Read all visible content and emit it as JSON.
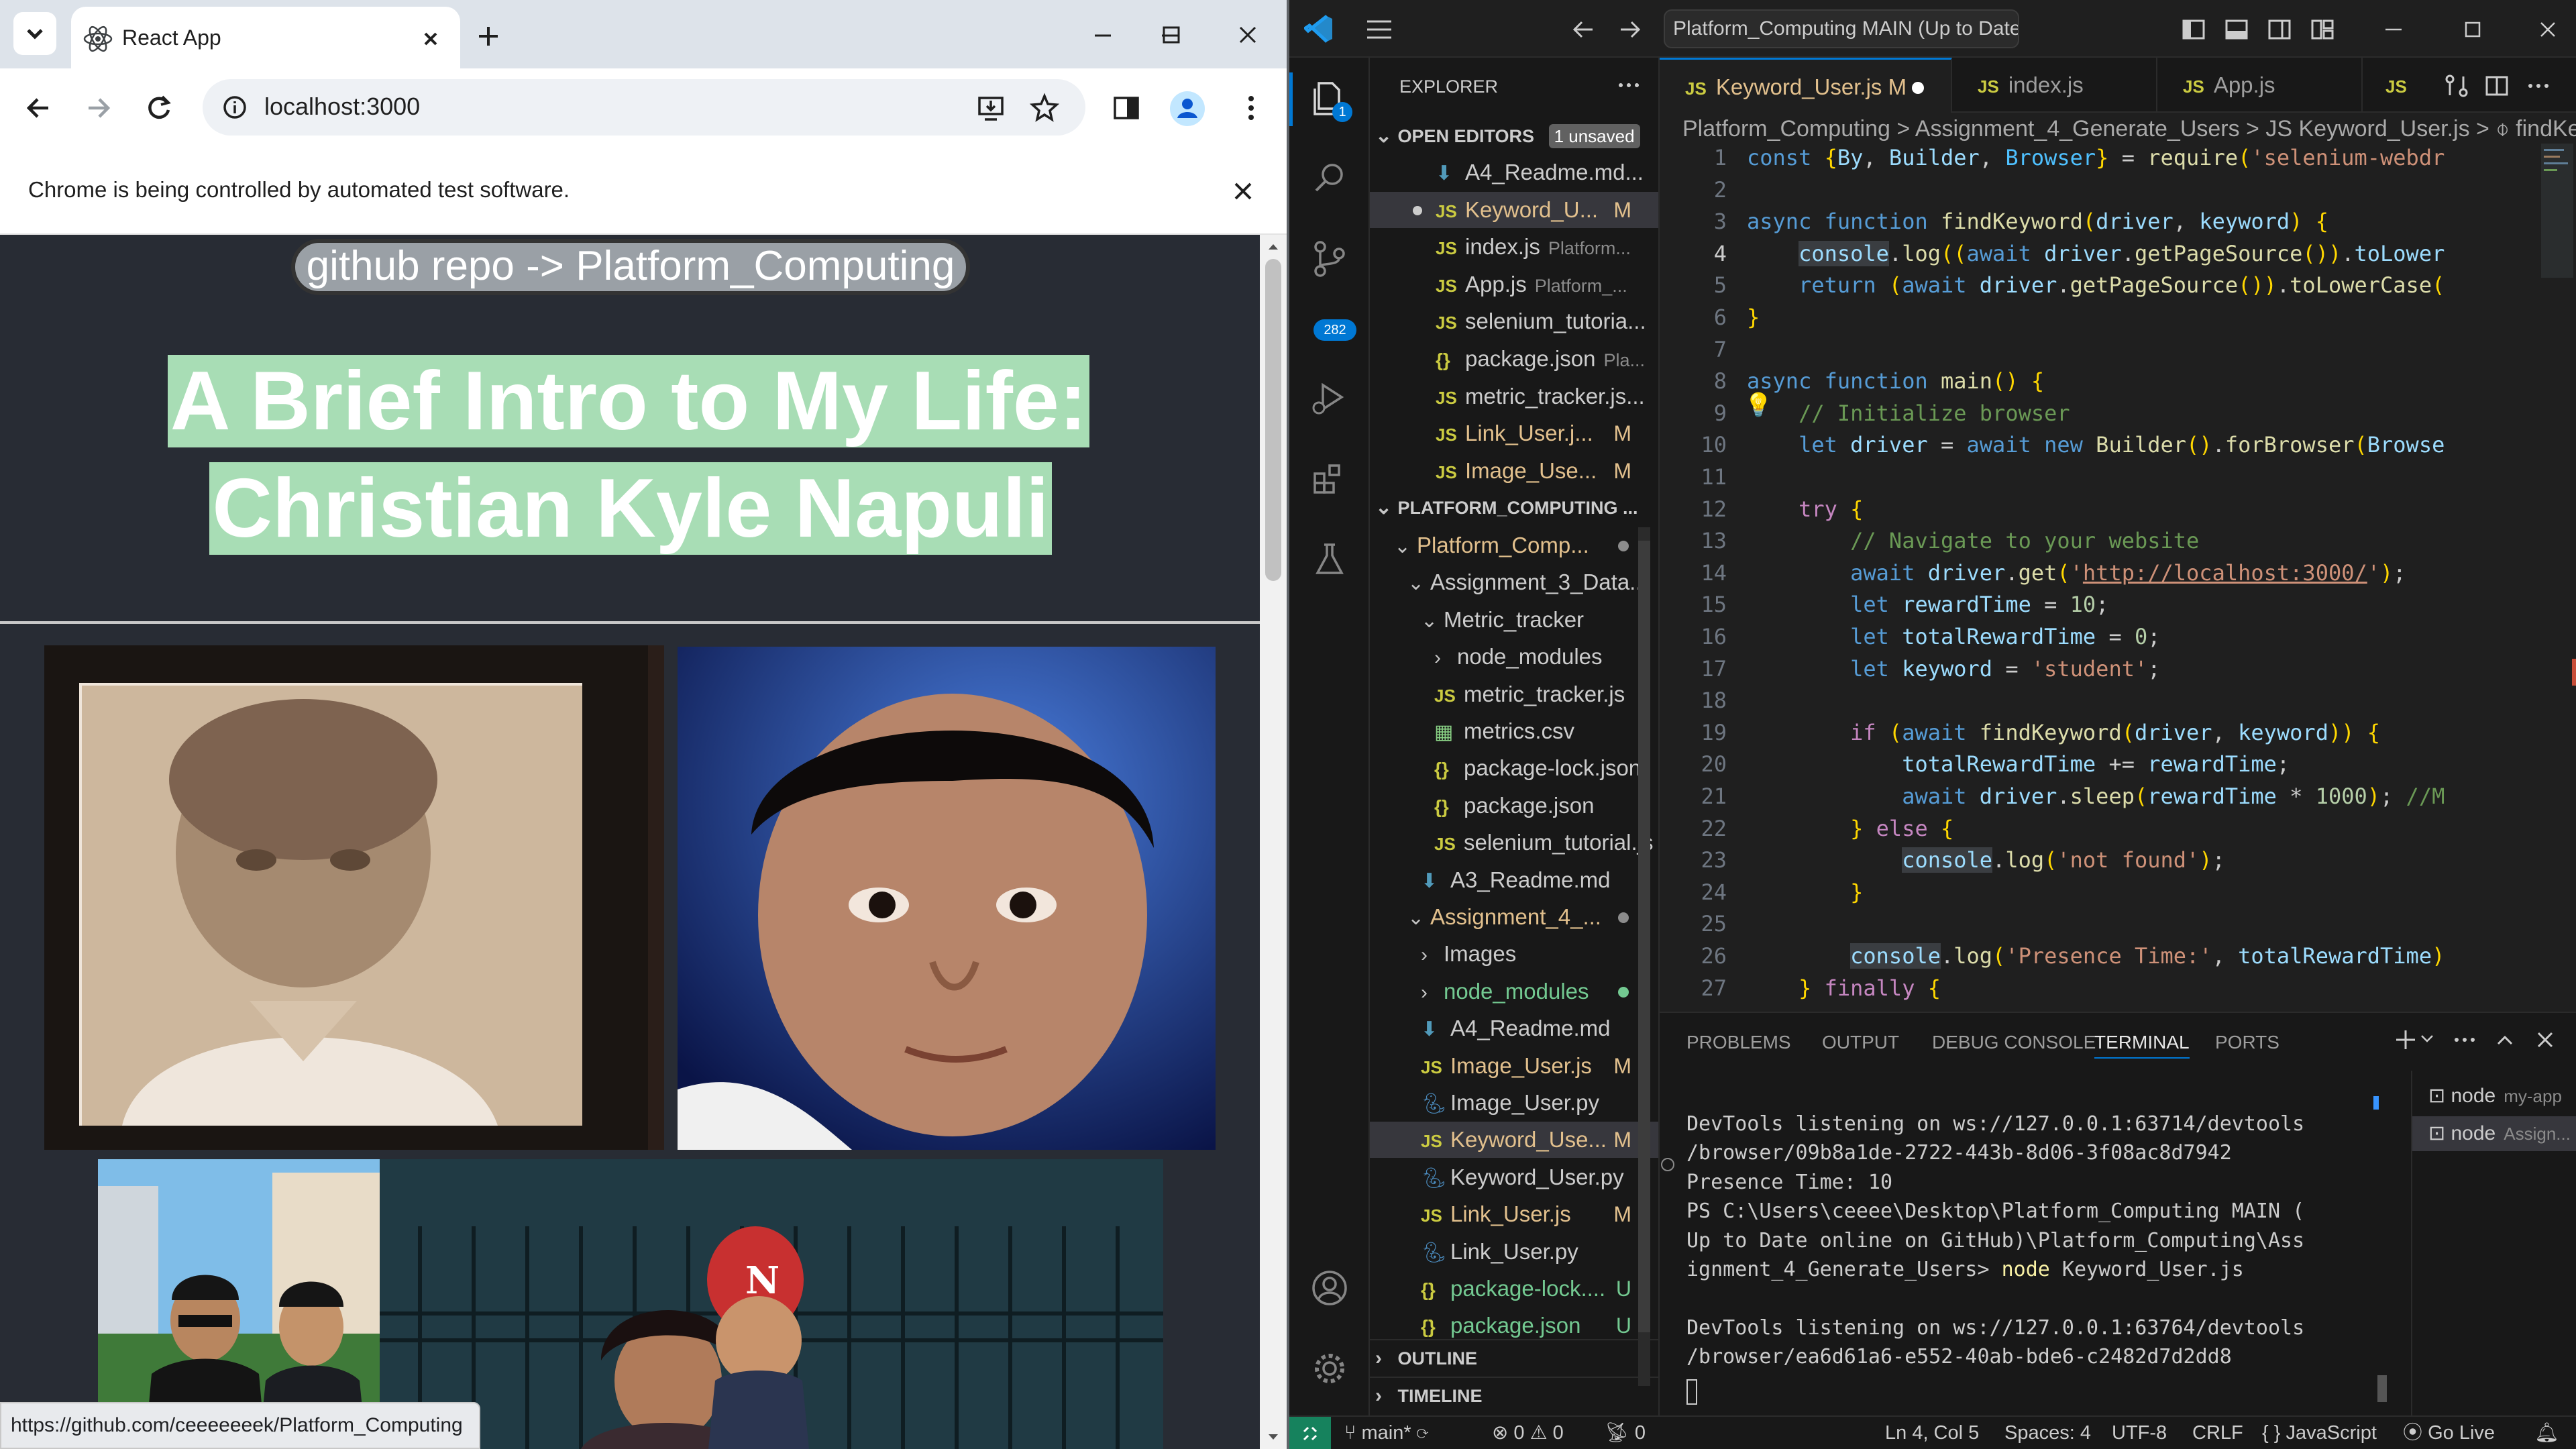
{
  "chrome": {
    "tab_title": "React App",
    "url": "localhost:3000",
    "automation_notice": "Chrome is being controlled by automated test software.",
    "status_link": "https://github.com/ceeeeeeek/Platform_Computing"
  },
  "page": {
    "repo_link": "github repo -> Platform_Computing",
    "title_line1": "A Brief Intro to My Life:",
    "title_line2": "Christian Kyle Napuli"
  },
  "vscode": {
    "command_center": "Platform_Computing MAIN (Up to Date online on GitH",
    "explorer_title": "EXPLORER",
    "open_editors_label": "OPEN EDITORS",
    "unsaved_badge": "1 unsaved",
    "open_editors": [
      {
        "name": "A4_Readme.md...",
        "type": "md",
        "badge": ""
      },
      {
        "name": "Keyword_U...",
        "type": "js",
        "badge": "M",
        "unsaved": true
      },
      {
        "name": "index.js",
        "type": "js",
        "badge": "",
        "hint": "Platform..."
      },
      {
        "name": "App.js",
        "type": "js",
        "badge": "",
        "hint": "Platform_..."
      },
      {
        "name": "selenium_tutoria...",
        "type": "js",
        "badge": ""
      },
      {
        "name": "package.json",
        "type": "json",
        "badge": "",
        "hint": "Pla..."
      },
      {
        "name": "metric_tracker.js...",
        "type": "js",
        "badge": ""
      },
      {
        "name": "Link_User.j...",
        "type": "js",
        "badge": "M"
      },
      {
        "name": "Image_Use...",
        "type": "js",
        "badge": "M"
      }
    ],
    "project_label": "PLATFORM_COMPUTING ...",
    "tree": [
      {
        "name": "Platform_Comp...",
        "indent": 1,
        "kind": "folder-open",
        "status": "dot-mod"
      },
      {
        "name": "Assignment_3_Data...",
        "indent": 2,
        "kind": "folder-open"
      },
      {
        "name": "Metric_tracker",
        "indent": 3,
        "kind": "folder-open"
      },
      {
        "name": "node_modules",
        "indent": 4,
        "kind": "folder"
      },
      {
        "name": "metric_tracker.js",
        "indent": 4,
        "kind": "js"
      },
      {
        "name": "metrics.csv",
        "indent": 4,
        "kind": "csv"
      },
      {
        "name": "package-lock.json",
        "indent": 4,
        "kind": "json"
      },
      {
        "name": "package.json",
        "indent": 4,
        "kind": "json"
      },
      {
        "name": "selenium_tutorial.js",
        "indent": 4,
        "kind": "js"
      },
      {
        "name": "A3_Readme.md",
        "indent": 3,
        "kind": "md"
      },
      {
        "name": "Assignment_4_...",
        "indent": 2,
        "kind": "folder-open",
        "status": "dot-mod"
      },
      {
        "name": "Images",
        "indent": 3,
        "kind": "folder"
      },
      {
        "name": "node_modules",
        "indent": 3,
        "kind": "folder",
        "status": "dot-untracked"
      },
      {
        "name": "A4_Readme.md",
        "indent": 3,
        "kind": "md"
      },
      {
        "name": "Image_User.js",
        "indent": 3,
        "kind": "js",
        "status": "M"
      },
      {
        "name": "Image_User.py",
        "indent": 3,
        "kind": "py"
      },
      {
        "name": "Keyword_Use...",
        "indent": 3,
        "kind": "js",
        "status": "M",
        "selected": true
      },
      {
        "name": "Keyword_User.py",
        "indent": 3,
        "kind": "py"
      },
      {
        "name": "Link_User.js",
        "indent": 3,
        "kind": "js",
        "status": "M"
      },
      {
        "name": "Link_User.py",
        "indent": 3,
        "kind": "py"
      },
      {
        "name": "package-lock....",
        "indent": 3,
        "kind": "json",
        "status": "U"
      },
      {
        "name": "package.json",
        "indent": 3,
        "kind": "json",
        "status": "U"
      }
    ],
    "outline_label": "OUTLINE",
    "timeline_label": "TIMELINE",
    "activity_badges": {
      "explorer": "1",
      "scm": "282"
    },
    "editor_tabs": [
      {
        "name": "Keyword_User.js",
        "badge": "M",
        "active": true
      },
      {
        "name": "index.js",
        "badge": ""
      },
      {
        "name": "App.js",
        "badge": ""
      }
    ],
    "breadcrumbs": "Platform_Computing > Assignment_4_Generate_Users > JS Keyword_User.js > ⌽ findKeyw",
    "code_lines": [
      "const {By, Builder, Browser} = require('selenium-webdr",
      "",
      "async function findKeyword(driver, keyword) {",
      "    console.log((await driver.getPageSource()).toLower",
      "    return (await driver.getPageSource()).toLowerCase(",
      "}",
      "",
      "async function main() {",
      "    // Initialize browser",
      "    let driver = await new Builder().forBrowser(Browse",
      "",
      "    try {",
      "        // Navigate to your website",
      "        await driver.get('http://localhost:3000/');",
      "        let rewardTime = 10;",
      "        let totalRewardTime = 0;",
      "        let keyword = 'student';",
      "",
      "        if (await findKeyword(driver, keyword)) {",
      "            totalRewardTime += rewardTime;",
      "            await driver.sleep(rewardTime * 1000); //M",
      "        } else {",
      "            console.log('not found');",
      "        }",
      "",
      "        console.log('Presence Time:', totalRewardTime)",
      "    } finally {"
    ],
    "panel_tabs": [
      "PROBLEMS",
      "OUTPUT",
      "DEBUG CONSOLE",
      "TERMINAL",
      "PORTS"
    ],
    "terminal_lines": [
      "DevTools listening on ws://127.0.0.1:63714/devtools",
      "/browser/09b8a1de-2722-443b-8d06-3f08ac8d7942",
      "Presence Time: 10",
      "PS C:\\Users\\ceeee\\Desktop\\Platform_Computing MAIN (",
      "Up to Date online on GitHub)\\Platform_Computing\\Ass",
      "ignment_4_Generate_Users> node Keyword_User.js",
      "",
      "DevTools listening on ws://127.0.0.1:63764/devtools",
      "/browser/ea6d61a6-e552-40ab-bde6-c2482d7d2dd8"
    ],
    "terminals": [
      {
        "name": "node",
        "hint": "my-app"
      },
      {
        "name": "node",
        "hint": "Assign..."
      }
    ],
    "status": {
      "branch": "main*",
      "errors": "0",
      "warnings": "0",
      "ports": "0",
      "position": "Ln 4, Col 5",
      "spaces": "Spaces: 4",
      "encoding": "UTF-8",
      "eol": "CRLF",
      "language": "JavaScript",
      "golive": "Go Live"
    }
  }
}
